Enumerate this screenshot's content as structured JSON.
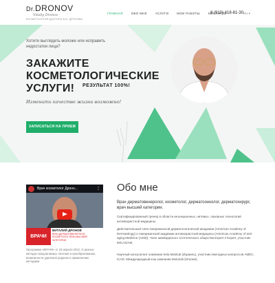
{
  "header": {
    "logo_prefix": "Dr.",
    "logo_name": "DRONOV",
    "logo_signature": "Vitaliy Dronov",
    "logo_tagline": "КОСМЕТОЛОГИЯ ДОКТОРА В.И. ДРОНОВА",
    "nav": [
      {
        "label": "ГЛАВНАЯ",
        "active": true
      },
      {
        "label": "ОБО МНЕ",
        "active": false
      },
      {
        "label": "УСЛУГИ",
        "active": false
      },
      {
        "label": "МОИ РАБОТЫ",
        "active": false
      },
      {
        "label": "КОНТАКТЫ",
        "active": false
      }
    ],
    "phone": "8 (910) 418-81-30",
    "lang": "RU ▾"
  },
  "hero": {
    "question": "Хотите выглядеть моложе или исправить недостатки лица?",
    "title": "ЗАКАЖИТЕ КОСМЕТОЛОГИЧЕСКИЕ УСЛУГИ!",
    "result": "РЕЗУЛЬТАТ 100%!",
    "subtitle": "Изменить качество жизни возможно!",
    "cta": "ЗАПИСАТЬСЯ НА ПРИЕМ"
  },
  "about": {
    "title": "Обо мне",
    "lead": "Врач дерматовенеролог, косметолог, дерматоонколог, дерматохирург, врач высшей категории.",
    "p1": "Сертифицированный тренер в области инъекционных, нитевых, лазерных технологий антивозрастной медицины.",
    "p2": "Действительный член Американской дерматологической академии (American Academy of Dermatology) и Американской академии антивозрастной медицины (American Academy of anti-aging Medicine (A4M)). Член швейцарского эстетического общества Expert 2 Expert, участник IMCAS/AM.",
    "p3": "Научный консультант компании Sela Medical (Израиль), участник ежегодных конгрессов АМЕС, ICAD. Международный кэш компании Motoriali (Италия)."
  },
  "video": {
    "title": "Врач косметолог Дроно...",
    "banner_red": "ВРАЧИ",
    "banner_name": "ВИТАЛИЙ ДРОНОВ",
    "banner_text": "ВРАЧ-ДЕРМАТОВЕНЕРОЛОГ, КОСМЕТОЛОГ ВРАЧ ВЫСШЕЙ КАТЕГОРИИ",
    "caption": "Программа «ВРАЧИ» от 23 апреля 2012. О разных методах предлагаемых лечения и преобразованию, возможности удаления родинок и применению методами."
  },
  "colors": {
    "accent": "#1fae6a",
    "triangle_light": "#9be0be",
    "triangle_mid": "#4fc28b"
  }
}
